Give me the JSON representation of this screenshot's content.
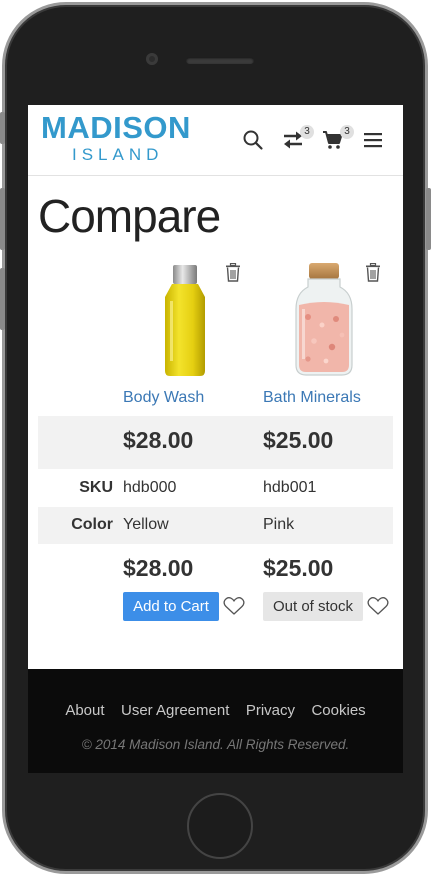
{
  "header": {
    "logo_top": "MADISON",
    "logo_bottom": "ISLAND",
    "compare_count": "3",
    "cart_count": "3",
    "icons": [
      "search-icon",
      "compare-icon",
      "cart-icon",
      "menu-icon"
    ]
  },
  "page": {
    "title": "Compare"
  },
  "labels": {
    "sku": "SKU",
    "color": "Color"
  },
  "products": [
    {
      "name": "Body Wash",
      "price": "$28.00",
      "sku": "hdb000",
      "color": "Yellow",
      "action": "Add to Cart",
      "in_stock": true
    },
    {
      "name": "Bath Minerals",
      "price": "$25.00",
      "sku": "hdb001",
      "color": "Pink",
      "action": "Out of stock",
      "in_stock": false
    }
  ],
  "footer": {
    "links": [
      "About",
      "User Agreement",
      "Privacy",
      "Cookies"
    ],
    "copyright": "© 2014 Madison Island. All Rights Reserved."
  },
  "colors": {
    "accent": "#3399cc",
    "link": "#3b78b5",
    "button": "#3c8ee8"
  }
}
